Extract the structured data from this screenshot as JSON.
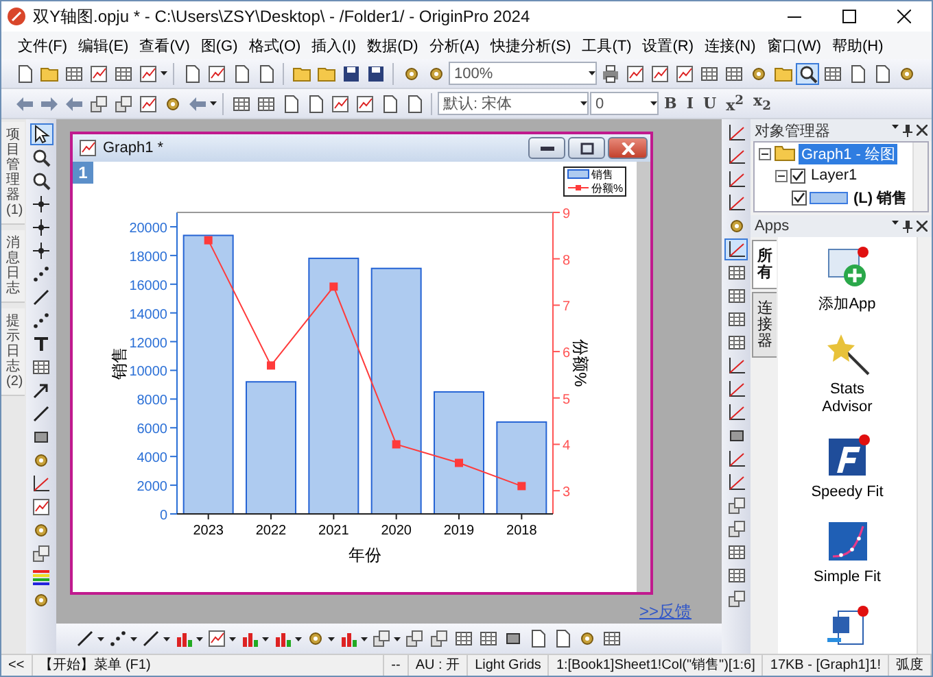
{
  "window": {
    "title": "双Y轴图.opju * - C:\\Users\\ZSY\\Desktop\\ - /Folder1/ - OriginPro 2024"
  },
  "menu": [
    "文件(F)",
    "编辑(E)",
    "查看(V)",
    "图(G)",
    "格式(O)",
    "插入(I)",
    "数据(D)",
    "分析(A)",
    "快捷分析(S)",
    "工具(T)",
    "设置(R)",
    "连接(N)",
    "窗口(W)",
    "帮助(H)"
  ],
  "toolbar": {
    "zoom": "100%",
    "font": "默认: 宋体",
    "font_size": "0",
    "format_buttons": [
      "B",
      "I",
      "U",
      "x$^{2}$",
      "x$_{2}$"
    ]
  },
  "left_dock_tabs": [
    "项目管理器 (1)",
    "消息日志",
    "提示日志 (2)"
  ],
  "graph_window": {
    "title": "Graph1 *",
    "layer": "1",
    "chart_data": {
      "type": "bar",
      "xlabel": "年份",
      "ylabel": "销售",
      "y2label": "份额%",
      "categories": [
        "2023",
        "2022",
        "2021",
        "2020",
        "2019",
        "2018"
      ],
      "series": [
        {
          "name": "销售",
          "type": "bar",
          "color": "#aecbf0",
          "values": [
            19400,
            9200,
            17800,
            17100,
            8500,
            6400
          ]
        },
        {
          "name": "份额%",
          "type": "line",
          "axis": "y2",
          "marker": "square",
          "color": "#ff3b3b",
          "values": [
            8.4,
            5.7,
            7.4,
            4.0,
            3.6,
            3.1
          ]
        }
      ],
      "ylim": [
        0,
        21000
      ],
      "yticks": [
        0,
        2000,
        4000,
        6000,
        8000,
        10000,
        12000,
        14000,
        16000,
        18000,
        20000
      ],
      "y2lim": [
        2.5,
        9
      ],
      "y2ticks": [
        3,
        4,
        5,
        6,
        7,
        8,
        9
      ],
      "legend": "upper right"
    }
  },
  "feedback_link": ">>反馈",
  "object_manager": {
    "title": "对象管理器",
    "tree": [
      {
        "label": "Graph1 - 绘图",
        "selected": true,
        "expanded": true,
        "children": [
          {
            "label": "Layer1",
            "checked": true,
            "expanded": true,
            "children": [
              {
                "label": "(L) 销售",
                "checked": true
              }
            ]
          }
        ]
      }
    ]
  },
  "apps": {
    "title": "Apps",
    "tabs": [
      {
        "label": "所有",
        "selected": true
      },
      {
        "label": "连接器",
        "selected": false
      }
    ],
    "items": [
      {
        "label": "添加App",
        "kind": "add"
      },
      {
        "label": "Stats Advisor",
        "kind": "wand"
      },
      {
        "label": "Speedy Fit",
        "kind": "speedy"
      },
      {
        "label": "Simple Fit",
        "kind": "curve"
      },
      {
        "kind": "word"
      }
    ]
  },
  "status_bar": [
    "<<",
    "【开始】菜单 (F1)",
    "--",
    "AU : 开",
    "Light Grids",
    "1:[Book1]Sheet1!Col(\"销售\")[1:6]",
    "17KB - [Graph1]1!",
    "弧度"
  ]
}
